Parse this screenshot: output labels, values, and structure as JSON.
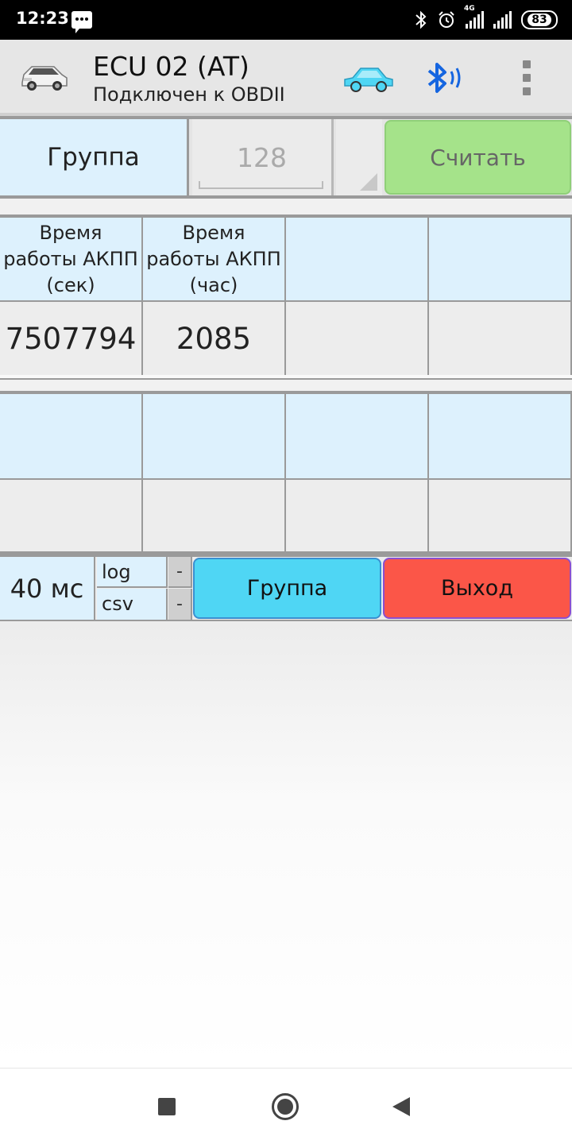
{
  "status_bar": {
    "time": "12:23",
    "network": "4G",
    "battery": "83",
    "icons": [
      "message-icon",
      "bluetooth-icon",
      "alarm-icon",
      "signal-icon",
      "wifi-icon",
      "battery-icon"
    ]
  },
  "app_bar": {
    "title": "ECU 02 (AT)",
    "subtitle": "Подключен к OBDII",
    "icons": [
      "car-photo-icon",
      "car-icon",
      "bluetooth-icon",
      "more-vert-icon"
    ],
    "colors": {
      "car_icon": "#4fd6f4",
      "bluetooth_icon": "#1565e0"
    }
  },
  "group_row": {
    "label": "Группа",
    "value": "128",
    "read_button": "Считать",
    "colors": {
      "read_button": "#a5e38a",
      "label_bg": "#ddf1fd"
    }
  },
  "table1": {
    "headers": [
      "Время работы АКПП (сек)",
      "Время работы АКПП (час)",
      "",
      ""
    ],
    "values": [
      "7507794",
      "2085",
      "",
      ""
    ]
  },
  "table2": {
    "headers": [
      "",
      "",
      "",
      ""
    ],
    "values": [
      "",
      "",
      "",
      ""
    ]
  },
  "controls": {
    "interval": "40 мс",
    "log_label": "log",
    "csv_label": "csv",
    "log_value": "-",
    "csv_value": "-",
    "group_button": "Группа",
    "exit_button": "Выход",
    "colors": {
      "group_button": "#4fd6f4",
      "exit_button": "#fb5648"
    }
  },
  "nav_bar": {
    "icons": [
      "recents-icon",
      "home-icon",
      "back-icon"
    ]
  }
}
